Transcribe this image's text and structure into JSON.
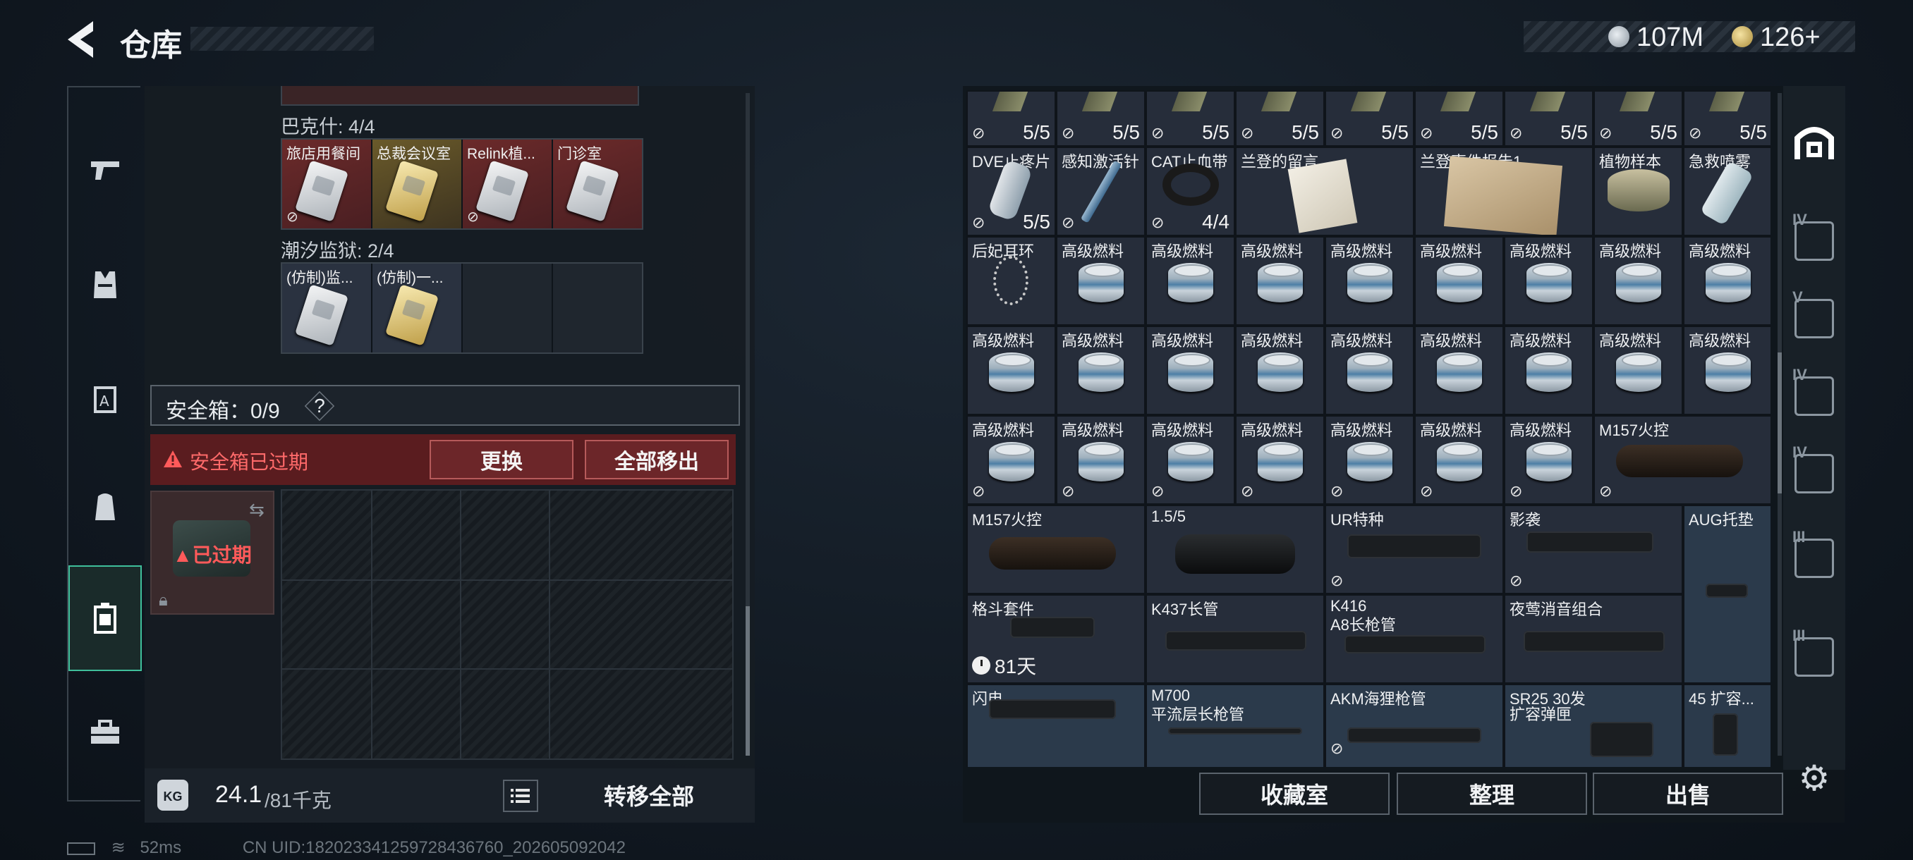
{
  "header": {
    "title": "仓库",
    "currency_silver": "107M",
    "currency_gold": "126+"
  },
  "left_nav": {
    "items": [
      {
        "name": "weapon-icon",
        "glyph": "⌐"
      },
      {
        "name": "vest-icon",
        "glyph": "Ⓜ"
      },
      {
        "name": "armor-icon",
        "glyph": "A"
      },
      {
        "name": "backpack-icon",
        "glyph": "☗"
      },
      {
        "name": "safebox-icon",
        "glyph": "▣"
      },
      {
        "name": "toolbox-icon",
        "glyph": "⌂"
      }
    ],
    "active_index": 4
  },
  "keycards": {
    "bakesh_label": "巴克什: 4/4",
    "bakesh_cards": [
      {
        "name": "旅店用餐间",
        "style": "red",
        "img": "white"
      },
      {
        "name": "总裁会议室",
        "style": "gold",
        "img": "gold"
      },
      {
        "name": "Relink植...",
        "style": "red",
        "img": "white"
      },
      {
        "name": "门诊室",
        "style": "red",
        "img": "white"
      }
    ],
    "prison_label": "潮汐监狱: 2/4",
    "prison_cards": [
      {
        "name": "(仿制)监...",
        "style": "blue",
        "img": "white"
      },
      {
        "name": "(仿制)一...",
        "style": "blue",
        "img": "gold"
      }
    ]
  },
  "safebox": {
    "label": "安全箱：0/9",
    "help": "?",
    "expired_warning": "安全箱已过期",
    "replace_button": "更换",
    "remove_all_button": "全部移出",
    "thumb_status": "已过期"
  },
  "weight": {
    "current": "24.1",
    "max": "/81千克",
    "transfer_all_button": "转移全部"
  },
  "inventory": {
    "ammo_counts": [
      "5/5",
      "5/5",
      "5/5",
      "5/5",
      "5/5",
      "5/5",
      "5/5",
      "5/5",
      "5/5"
    ],
    "row_medical": [
      {
        "name": "DVE止疼片",
        "count": "5/5"
      },
      {
        "name": "感知激活针",
        "count": ""
      },
      {
        "name": "CAT止血带",
        "count": "4/4"
      },
      {
        "name": "兰登的留言",
        "count": ""
      },
      {
        "name": "兰登事件报告1",
        "count": ""
      },
      {
        "name": "植物样本",
        "count": ""
      },
      {
        "name": "急救喷雾",
        "count": ""
      }
    ],
    "earring": "后妃耳环",
    "fuel": "高级燃料",
    "m157": "M157火控",
    "scope_label": "1.5/5",
    "ur_stock": "UR特种",
    "shadow": "影袭",
    "aug_pad": "AUG托垫",
    "combat_kit": "格斗套件",
    "combat_timer": "81天",
    "k437": "K437长管",
    "k416_line1": "K416",
    "k416_line2": "A8长枪管",
    "nightingale": "夜莺消音组合",
    "lightning": "闪电",
    "m700_line1": "M700",
    "m700_line2": "平流层长枪管",
    "akm": "AKM海狸枪管",
    "sr25_line1": "SR25 30发",
    "sr25_line2": "扩容弹匣",
    "ext45": "45 扩容..."
  },
  "actions": {
    "collection_button": "收藏室",
    "organize_button": "整理",
    "sell_button": "出售"
  },
  "right_sidebar": {
    "items": [
      "IV",
      "V",
      "IV",
      "IV",
      "III",
      "III"
    ]
  },
  "status": {
    "ping": "52ms",
    "uid": "CN UID:182023341259728436760_202605092042"
  }
}
